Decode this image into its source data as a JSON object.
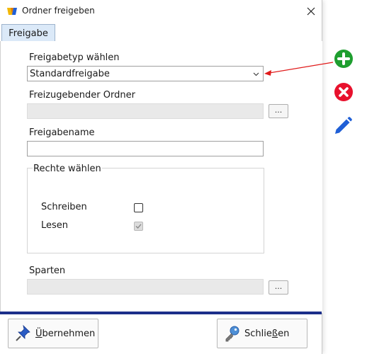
{
  "window": {
    "title": "Ordner freigeben",
    "close_label": "×"
  },
  "tabs": [
    {
      "label": "Freigabe",
      "selected": true
    }
  ],
  "form": {
    "share_type_label": "Freigabetyp wählen",
    "share_type_value": "Standardfreigabe",
    "folder_label": "Freizugebender Ordner",
    "folder_value": "",
    "folder_browse_label": "...",
    "share_name_label": "Freigabename",
    "share_name_value": "",
    "rights_group_label": "Rechte wählen",
    "write_label": "Schreiben",
    "write_checked": false,
    "read_label": "Lesen",
    "read_checked": true,
    "sections_label": "Sparten",
    "sections_value": "",
    "sections_browse_label": "..."
  },
  "footer": {
    "apply_prefix": "",
    "apply_underline": "Ü",
    "apply_rest": "bernehmen",
    "close_prefix": "Schlie",
    "close_underline": "ß",
    "close_rest": "en"
  },
  "side_toolbar": [
    {
      "icon": "add-circle-icon",
      "color": "#1e9e2f"
    },
    {
      "icon": "delete-circle-icon",
      "color": "#e8112d"
    },
    {
      "icon": "edit-pencil-icon",
      "color": "#1f5fd6"
    }
  ],
  "colors": {
    "accent_bar": "#1c2f8a",
    "tab_selected": "#dbe9f8",
    "annotation_arrow": "#e01b1b"
  }
}
